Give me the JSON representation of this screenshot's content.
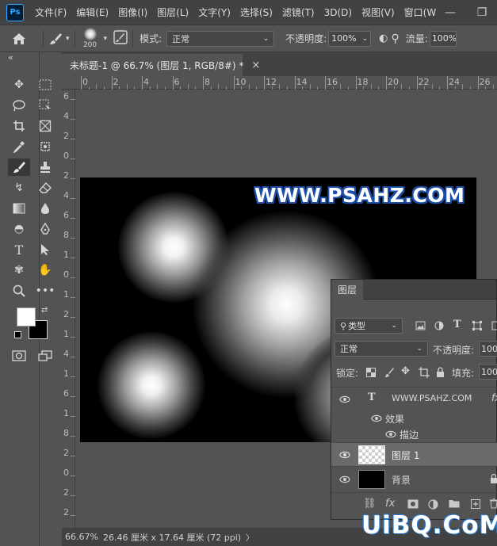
{
  "menubar": {
    "logo": "Ps",
    "items": [
      "文件(F)",
      "编辑(E)",
      "图像(I)",
      "图层(L)",
      "文字(Y)",
      "选择(S)",
      "滤镜(T)",
      "3D(D)",
      "视图(V)",
      "窗口(W"
    ],
    "minimize": "—",
    "restore": "❐"
  },
  "options": {
    "brush_size": "200",
    "mode_label": "模式:",
    "mode_value": "正常",
    "opacity_label": "不透明度:",
    "opacity_value": "100%",
    "flow_label": "流量:",
    "flow_value": "100%"
  },
  "panel_collapse": "«",
  "document": {
    "tab_title": "未标题-1 @ 66.7% (图层 1, RGB/8#) *",
    "close": "×",
    "watermark": "WWW.PSAHZ.COM"
  },
  "rulers": {
    "h_ticks": [
      "0",
      "2",
      "4",
      "6",
      "8",
      "10",
      "12",
      "14",
      "16",
      "18",
      "20",
      "22",
      "24",
      "26"
    ],
    "v_ticks": [
      "6",
      "4",
      "2",
      "0",
      "2",
      "4",
      "6",
      "8",
      "1",
      "0",
      "1",
      "2",
      "1",
      "4",
      "1",
      "6",
      "1",
      "8",
      "2",
      "0",
      "2",
      "2"
    ]
  },
  "status": {
    "zoom": "66.67%",
    "info": "26.46 厘米 x 17.64 厘米 (72 ppi)",
    "arrow": "〉"
  },
  "layers_panel": {
    "tab": "图层",
    "filter_kind": "类型",
    "blend_mode": "正常",
    "opacity_label": "不透明度:",
    "opacity_value": "100",
    "lock_label": "锁定:",
    "fill_label": "填充:",
    "fill_value": "100",
    "layers": [
      {
        "name": "WWW.PSAHZ.COM",
        "type": "text",
        "badge": "fx"
      },
      {
        "name": "效果",
        "type": "effects"
      },
      {
        "name": "描边",
        "type": "effect"
      },
      {
        "name": "图层 1",
        "type": "pixel"
      },
      {
        "name": "背景",
        "type": "background"
      }
    ]
  },
  "brand_watermark": "UiBQ.CoM",
  "colors": {
    "accent_blue": "#1d4fa8",
    "ps_blue": "#31a8ff"
  }
}
